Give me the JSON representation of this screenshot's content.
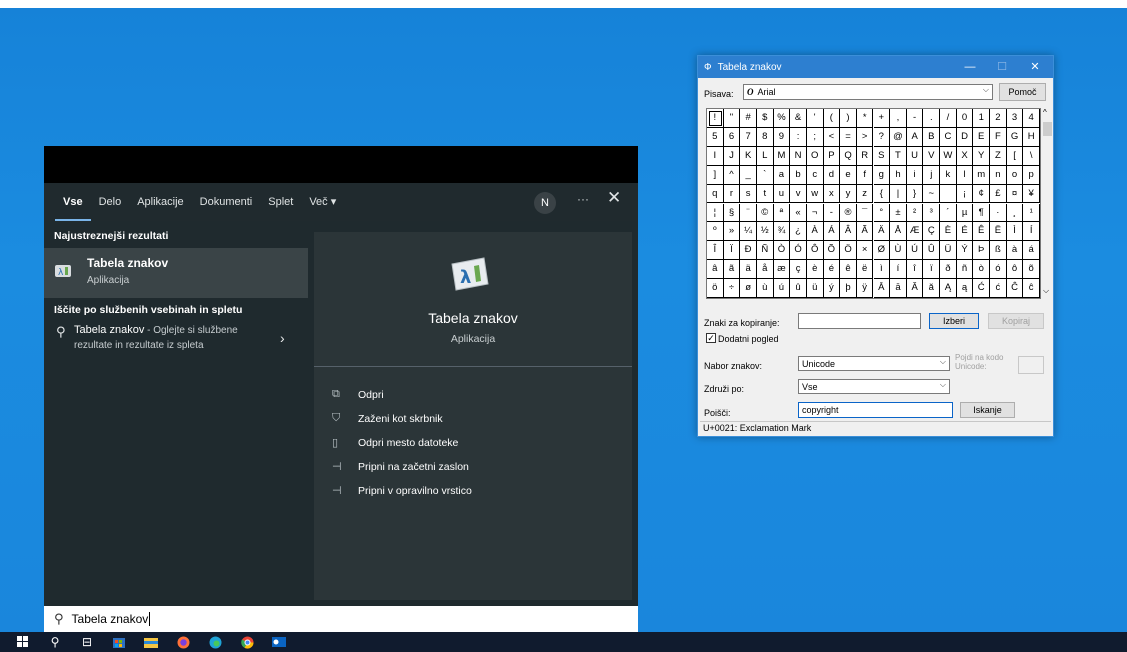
{
  "start_menu": {
    "tabs": [
      "Vse",
      "Delo",
      "Aplikacije",
      "Dokumenti",
      "Splet",
      "Več ▾"
    ],
    "avatar_letter": "N",
    "more_label": "···",
    "close_label": "✕",
    "best_match_header": "Najustreznejši rezultati",
    "best_match": {
      "title": "Tabela znakov",
      "subtitle": "Aplikacija"
    },
    "web_header": "Iščite po službenih vsebinah in spletu",
    "web_result": {
      "title": "Tabela znakov",
      "dash": " - ",
      "rest": "Oglejte si službene rezultate in rezultate iz spleta"
    },
    "preview": {
      "title": "Tabela znakov",
      "subtitle": "Aplikacija"
    },
    "actions": [
      {
        "icon": "open-icon",
        "label": "Odpri"
      },
      {
        "icon": "shield-icon",
        "label": "Zaženi kot skrbnik"
      },
      {
        "icon": "file-location-icon",
        "label": "Odpri mesto datoteke"
      },
      {
        "icon": "pin-icon",
        "label": "Pripni na začetni zaslon"
      },
      {
        "icon": "pin-icon",
        "label": "Pripni v opravilno vrstico"
      }
    ],
    "search_value": "Tabela znakov"
  },
  "taskbar": {
    "icons": [
      "windows-start-icon",
      "search-icon",
      "task-view-icon",
      "store-icon",
      "file-explorer-icon",
      "firefox-icon",
      "edge-icon",
      "chrome-icon",
      "outlook-icon"
    ]
  },
  "charmap": {
    "title": "Tabela znakov",
    "font_label": "Pisava:",
    "font_value": "Arial",
    "help_button": "Pomoč",
    "copy_label": "Znaki za kopiranje:",
    "copy_value": "",
    "select_button": "Izberi",
    "copy_button": "Kopiraj",
    "advanced_label": "Dodatni pogled",
    "charset_label": "Nabor znakov:",
    "charset_value": "Unicode",
    "goto_label": "Pojdi na kodo Unicode:",
    "group_label": "Združi po:",
    "group_value": "Vse",
    "search_label": "Poišči:",
    "search_value": "copyright",
    "search_button": "Iskanje",
    "status": "U+0021: Exclamation Mark",
    "rows": [
      [
        "!",
        "\"",
        "#",
        "$",
        "%",
        "&",
        "'",
        "(",
        ")",
        "*",
        "+",
        ",",
        "-",
        ".",
        "/",
        "0",
        "1",
        "2",
        "3",
        "4"
      ],
      [
        "5",
        "6",
        "7",
        "8",
        "9",
        ":",
        ";",
        "<",
        "=",
        ">",
        "?",
        "@",
        "A",
        "B",
        "C",
        "D",
        "E",
        "F",
        "G",
        "H"
      ],
      [
        "I",
        "J",
        "K",
        "L",
        "M",
        "N",
        "O",
        "P",
        "Q",
        "R",
        "S",
        "T",
        "U",
        "V",
        "W",
        "X",
        "Y",
        "Z",
        "[",
        "\\"
      ],
      [
        "]",
        "^",
        "_",
        "`",
        "a",
        "b",
        "c",
        "d",
        "e",
        "f",
        "g",
        "h",
        "i",
        "j",
        "k",
        "l",
        "m",
        "n",
        "o",
        "p"
      ],
      [
        "q",
        "r",
        "s",
        "t",
        "u",
        "v",
        "w",
        "x",
        "y",
        "z",
        "{",
        "|",
        "}",
        "~",
        " ",
        "¡",
        "¢",
        "£",
        "¤",
        "¥"
      ],
      [
        "¦",
        "§",
        "¨",
        "©",
        "ª",
        "«",
        "¬",
        "-",
        "®",
        "¯",
        "°",
        "±",
        "²",
        "³",
        "´",
        "µ",
        "¶",
        "·",
        "¸",
        "¹"
      ],
      [
        "º",
        "»",
        "¼",
        "½",
        "¾",
        "¿",
        "À",
        "Á",
        "Â",
        "Ã",
        "Ä",
        "Å",
        "Æ",
        "Ç",
        "È",
        "É",
        "Ê",
        "Ë",
        "Ì",
        "Í"
      ],
      [
        "Î",
        "Ï",
        "Ð",
        "Ñ",
        "Ò",
        "Ó",
        "Ô",
        "Õ",
        "Ö",
        "×",
        "Ø",
        "Ù",
        "Ú",
        "Û",
        "Ü",
        "Ý",
        "Þ",
        "ß",
        "à",
        "á"
      ],
      [
        "â",
        "ã",
        "ä",
        "å",
        "æ",
        "ç",
        "è",
        "é",
        "ê",
        "ë",
        "ì",
        "í",
        "î",
        "ï",
        "ð",
        "ñ",
        "ò",
        "ó",
        "ô",
        "õ"
      ],
      [
        "ö",
        "÷",
        "ø",
        "ù",
        "ú",
        "û",
        "ü",
        "ý",
        "þ",
        "ÿ",
        "Ā",
        "ā",
        "Ă",
        "ă",
        "Ą",
        "ą",
        "Ć",
        "ć",
        "Ĉ",
        "ĉ"
      ]
    ]
  }
}
